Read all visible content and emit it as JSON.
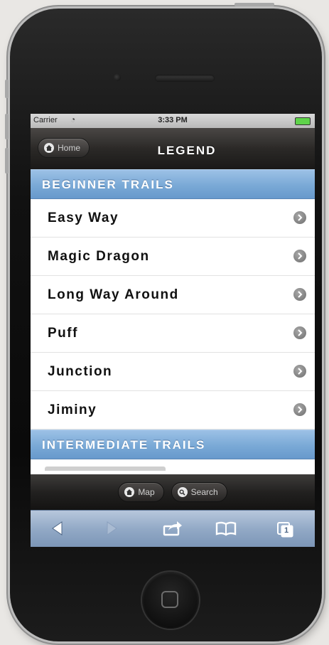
{
  "status_bar": {
    "carrier": "Carrier",
    "time": "3:33 PM"
  },
  "nav_bar": {
    "back_label": "Home",
    "title": "LEGEND"
  },
  "sections": [
    {
      "header": "BEGINNER TRAILS",
      "items": [
        {
          "label": "Easy Way"
        },
        {
          "label": "Magic Dragon"
        },
        {
          "label": "Long Way Around"
        },
        {
          "label": "Puff"
        },
        {
          "label": "Junction"
        },
        {
          "label": "Jiminy"
        }
      ]
    },
    {
      "header": "INTERMEDIATE TRAILS",
      "items": []
    }
  ],
  "app_toolbar": {
    "map_label": "Map",
    "search_label": "Search"
  },
  "browser_toolbar": {
    "icons": [
      "back-arrow-icon",
      "forward-arrow-icon",
      "share-icon",
      "bookmarks-icon",
      "tabs-icon"
    ],
    "tabs_count": "1"
  },
  "colors": {
    "section_header": "#7aa9d6",
    "nav_bar": "#2b2927",
    "browser_toolbar": "#92a9c6",
    "battery": "#5fd34a"
  }
}
